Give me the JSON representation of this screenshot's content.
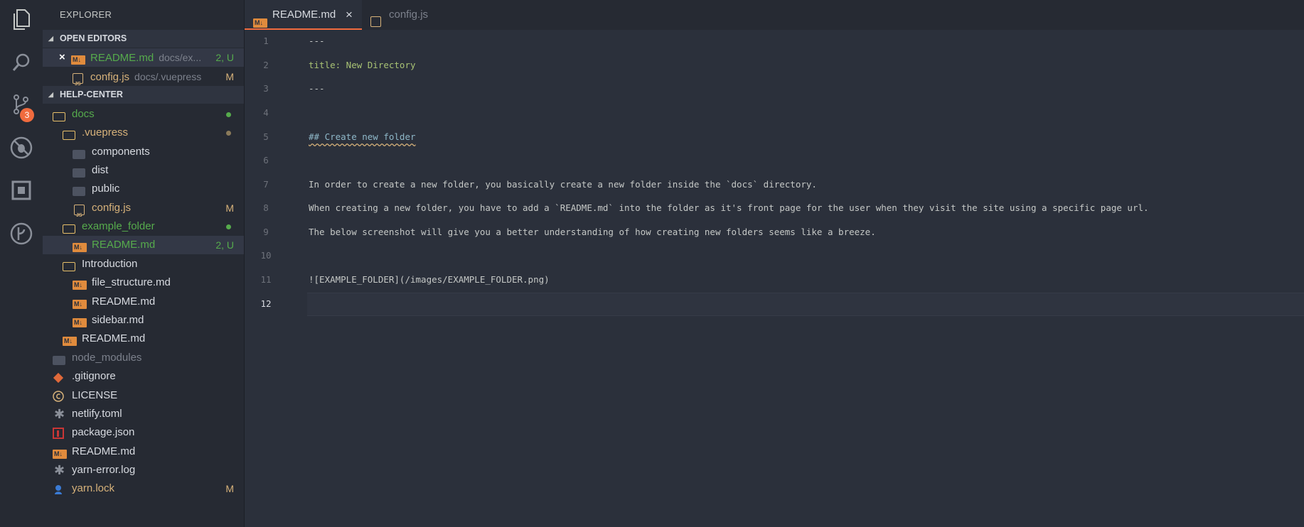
{
  "activity_bar": {
    "icons": [
      "files-icon",
      "search-icon",
      "source-control-icon",
      "debug-icon",
      "extensions-icon",
      "git-lens-icon"
    ],
    "scm_badge": "3"
  },
  "explorer": {
    "title": "EXPLORER",
    "open_editors": {
      "header": "OPEN EDITORS",
      "items": [
        {
          "name": "README.md",
          "desc": "docs/ex...",
          "status": "2, U"
        },
        {
          "name": "config.js",
          "desc": "docs/.vuepress",
          "status": "M"
        }
      ]
    },
    "project": {
      "header": "HELP-CENTER",
      "items": [
        {
          "name": "docs",
          "status": ""
        },
        {
          "name": ".vuepress",
          "status": ""
        },
        {
          "name": "components",
          "status": ""
        },
        {
          "name": "dist",
          "status": ""
        },
        {
          "name": "public",
          "status": ""
        },
        {
          "name": "config.js",
          "status": "M"
        },
        {
          "name": "example_folder",
          "status": ""
        },
        {
          "name": "README.md",
          "status": "2, U"
        },
        {
          "name": "Introduction",
          "status": ""
        },
        {
          "name": "file_structure.md",
          "status": ""
        },
        {
          "name": "README.md",
          "status": ""
        },
        {
          "name": "sidebar.md",
          "status": ""
        },
        {
          "name": "README.md",
          "status": ""
        },
        {
          "name": "node_modules",
          "status": ""
        },
        {
          "name": ".gitignore",
          "status": ""
        },
        {
          "name": "LICENSE",
          "status": ""
        },
        {
          "name": "netlify.toml",
          "status": ""
        },
        {
          "name": "package.json",
          "status": ""
        },
        {
          "name": "README.md",
          "status": ""
        },
        {
          "name": "yarn-error.log",
          "status": ""
        },
        {
          "name": "yarn.lock",
          "status": "M"
        }
      ]
    }
  },
  "tabs": [
    {
      "label": "README.md",
      "close": "×"
    },
    {
      "label": "config.js"
    }
  ],
  "editor": {
    "line_numbers": [
      "1",
      "2",
      "3",
      "4",
      "5",
      "6",
      "7",
      "8",
      "9",
      "10",
      "11",
      "12"
    ],
    "lines": [
      "---",
      "title: New Directory",
      "---",
      "",
      "## Create new folder",
      "",
      "In order to create a new folder, you basically create a new folder inside the `docs` directory.",
      "When creating a new folder, you have to add a `README.md` into the folder as it's front page for the user when they visit the site using a specific page url.",
      "The below screenshot will give you a better understanding of how creating new folders seems like a breeze.",
      "",
      "![EXAMPLE_FOLDER](/images/EXAMPLE_FOLDER.png)",
      ""
    ]
  },
  "colors": {
    "accent": "#f06b3e",
    "untracked_green": "#56ab4c",
    "modified_yellow": "#d7b27a",
    "background": "#262a33",
    "editor_background": "#2b303b"
  }
}
